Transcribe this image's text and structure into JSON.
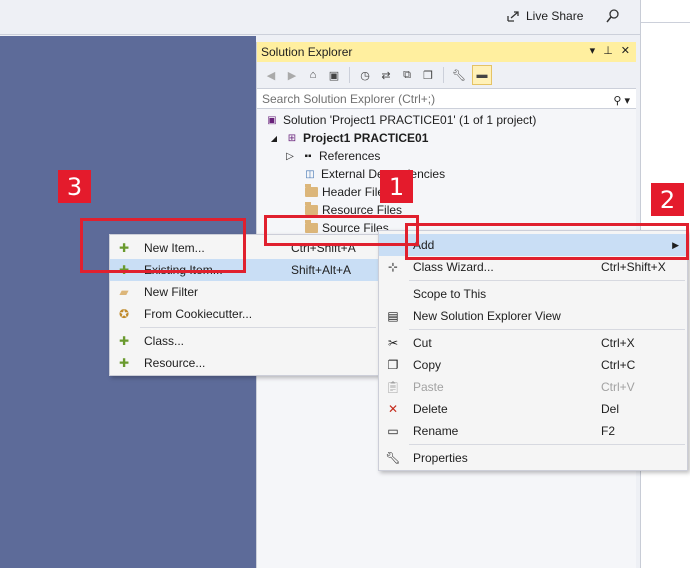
{
  "topbar": {
    "live_share": "Live Share"
  },
  "solution_explorer": {
    "title": "Solution Explorer",
    "search_placeholder": "Search Solution Explorer (Ctrl+;)",
    "tree": {
      "solution": "Solution 'Project1 PRACTICE01' (1 of 1 project)",
      "project": "Project1 PRACTICE01",
      "references": "References",
      "external": "External Dependencies",
      "header_files": "Header Files",
      "resource_files": "Resource Files",
      "source_files": "Source Files"
    }
  },
  "context_menu": {
    "add": "Add",
    "class_wizard": "Class Wizard...",
    "class_wizard_sc": "Ctrl+Shift+X",
    "scope": "Scope to This",
    "new_view": "New Solution Explorer View",
    "cut": "Cut",
    "cut_sc": "Ctrl+X",
    "copy": "Copy",
    "copy_sc": "Ctrl+C",
    "paste": "Paste",
    "paste_sc": "Ctrl+V",
    "delete": "Delete",
    "delete_sc": "Del",
    "rename": "Rename",
    "rename_sc": "F2",
    "properties": "Properties"
  },
  "add_submenu": {
    "new_item": "New Item...",
    "new_item_sc": "Ctrl+Shift+A",
    "existing_item": "Existing Item...",
    "existing_item_sc": "Shift+Alt+A",
    "new_filter": "New Filter",
    "cookiecutter": "From Cookiecutter...",
    "class": "Class...",
    "resource": "Resource..."
  },
  "badges": {
    "one": "1",
    "two": "2",
    "three": "3"
  }
}
